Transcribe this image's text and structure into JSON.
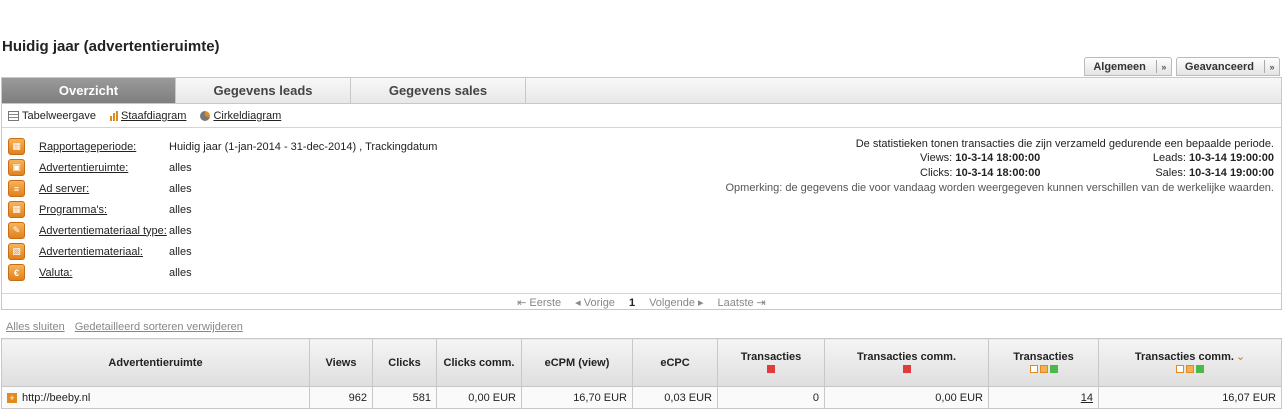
{
  "page_title": "Huidig jaar (advertentieruimte)",
  "view_buttons": [
    {
      "label": "Algemeen"
    },
    {
      "label": "Geavanceerd"
    }
  ],
  "tabs": [
    {
      "label": "Overzicht",
      "active": true
    },
    {
      "label": "Gegevens leads"
    },
    {
      "label": "Gegevens sales"
    }
  ],
  "viewbar": {
    "table": "Tabelweergave",
    "bar": "Staafdiagram",
    "pie": "Cirkeldiagram"
  },
  "filters": [
    {
      "label": "Rapportageperiode:",
      "value": "Huidig jaar (1-jan-2014 - 31-dec-2014) , Trackingdatum",
      "icon": "calendar-icon"
    },
    {
      "label": "Advertentieruimte:",
      "value": "alles",
      "icon": "ad-space-icon"
    },
    {
      "label": "Ad server:",
      "value": "alles",
      "icon": "server-icon"
    },
    {
      "label": "Programma's:",
      "value": "alles",
      "icon": "programs-icon"
    },
    {
      "label": "Advertentiemateriaal type:",
      "value": "alles",
      "icon": "material-type-icon"
    },
    {
      "label": "Advertentiemateriaal:",
      "value": "alles",
      "icon": "material-icon"
    },
    {
      "label": "Valuta:",
      "value": "alles",
      "icon": "currency-icon"
    }
  ],
  "info": {
    "intro": "De statistieken tonen transacties die zijn verzameld gedurende een bepaalde periode.",
    "views_label": "Views:",
    "views_value": "10-3-14 18:00:00",
    "clicks_label": "Clicks:",
    "clicks_value": "10-3-14 18:00:00",
    "leads_label": "Leads:",
    "leads_value": "10-3-14 19:00:00",
    "sales_label": "Sales:",
    "sales_value": "10-3-14 19:00:00",
    "note": "Opmerking: de gegevens die voor vandaag worden weergegeven kunnen verschillen van de werkelijke waarden."
  },
  "pager": {
    "first": "Eerste",
    "prev": "Vorige",
    "current": "1",
    "next": "Volgende",
    "last": "Laatste"
  },
  "links": {
    "close_all": "Alles sluiten",
    "remove_sort": "Gedetailleerd sorteren verwijderen"
  },
  "table": {
    "headers": [
      "Advertentieruimte",
      "Views",
      "Clicks",
      "Clicks comm.",
      "eCPM (view)",
      "eCPC",
      "Transacties",
      "Transacties comm.",
      "Transacties",
      "Transacties comm."
    ],
    "rows": [
      {
        "name": "http://beeby.nl",
        "views": "962",
        "clicks": "581",
        "clicks_comm": "0,00 EUR",
        "ecpm": "16,70 EUR",
        "ecpc": "0,03 EUR",
        "trans": "0",
        "trans_comm": "0,00 EUR",
        "trans2": "14",
        "trans_comm2": "16,07 EUR"
      }
    ]
  },
  "colors": {
    "accent": "#e28a1e",
    "red": "#e23b3b",
    "green": "#4cb848"
  }
}
